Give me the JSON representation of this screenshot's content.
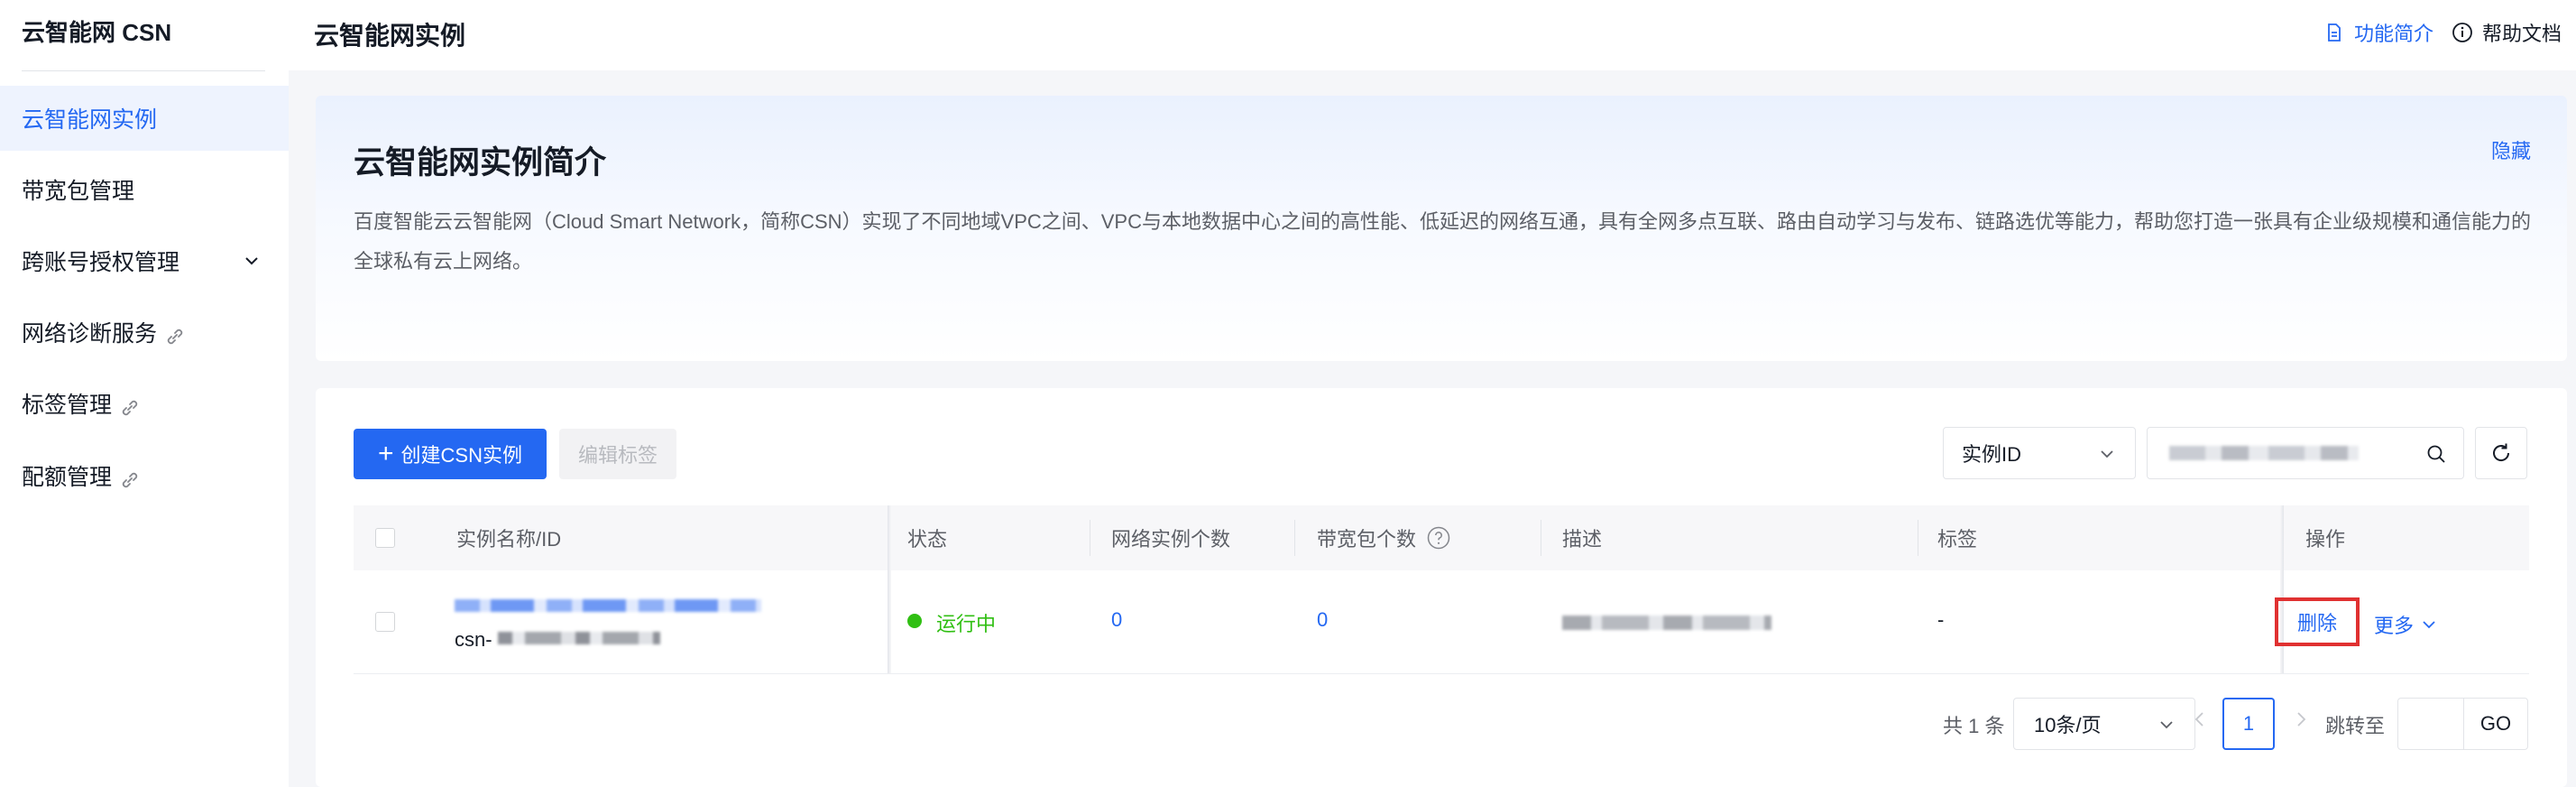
{
  "sidebar": {
    "brand": "云智能网 CSN",
    "items": [
      {
        "label": "云智能网实例",
        "active": true
      },
      {
        "label": "带宽包管理"
      },
      {
        "label": "跨账号授权管理",
        "icon": "chevron-down-icon"
      },
      {
        "label": "网络诊断服务",
        "icon": "external-link-icon"
      },
      {
        "label": "标签管理",
        "icon": "external-link-icon"
      },
      {
        "label": "配额管理",
        "icon": "external-link-icon"
      }
    ]
  },
  "header": {
    "title": "云智能网实例",
    "feature_intro": "功能简介",
    "help_docs": "帮助文档"
  },
  "intro": {
    "title": "云智能网实例简介",
    "hide": "隐藏",
    "description": "百度智能云云智能网（Cloud Smart Network，简称CSN）实现了不同地域VPC之间、VPC与本地数据中心之间的高性能、低延迟的网络互通，具有全网多点互联、路由自动学习与发布、链路选优等能力，帮助您打造一张具有企业级规模和通信能力的全球私有云上网络。"
  },
  "toolbar": {
    "create_button": "创建CSN实例",
    "edit_tags_button": "编辑标签",
    "filter_select": "实例ID"
  },
  "table": {
    "columns": [
      "实例名称/ID",
      "状态",
      "网络实例个数",
      "带宽包个数",
      "描述",
      "标签",
      "操作"
    ],
    "rows": [
      {
        "id_prefix": "csn-",
        "status": "运行中",
        "network_instances": "0",
        "bandwidth_packages": "0",
        "tags": "-",
        "action_delete": "删除",
        "action_more": "更多"
      }
    ]
  },
  "pagination": {
    "total": "共 1 条",
    "page_size": "10条/页",
    "current_page": "1",
    "jump_label": "跳转至",
    "go": "GO"
  },
  "colors": {
    "primary": "#2468f2",
    "running": "#30bf13",
    "highlight_box": "#e03131"
  }
}
